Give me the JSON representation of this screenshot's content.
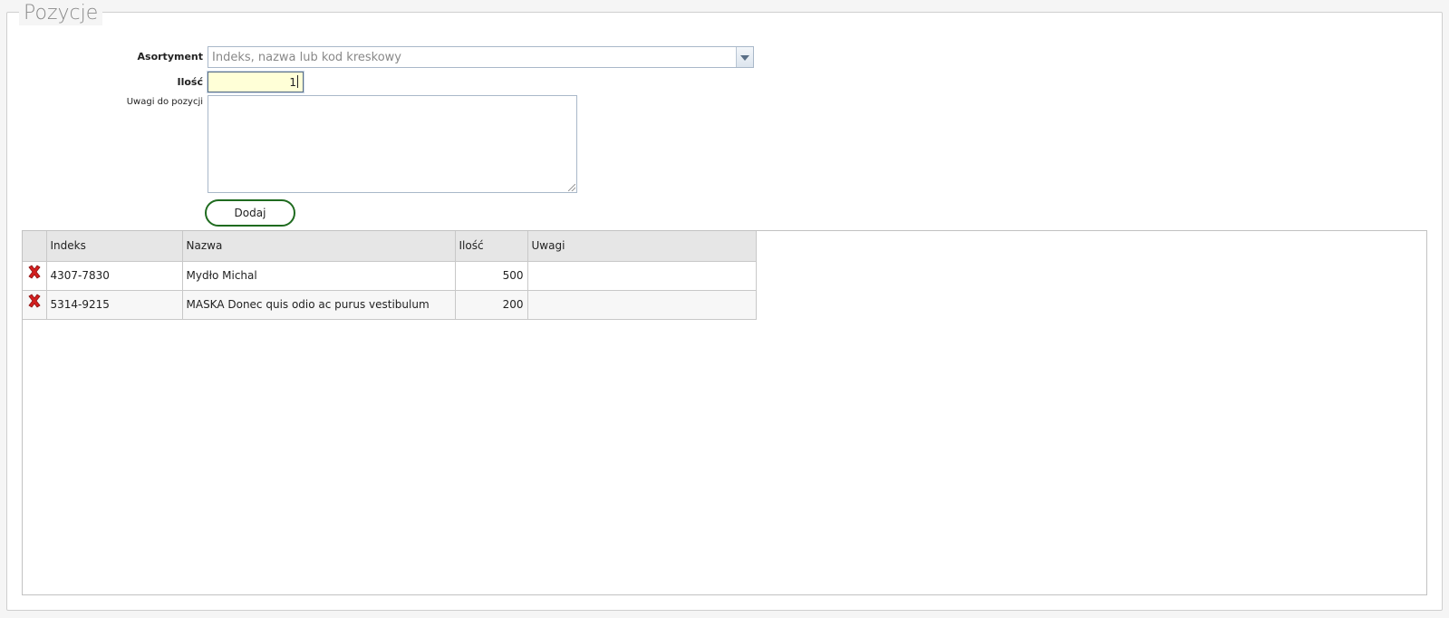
{
  "section": {
    "title": "Pozycje"
  },
  "form": {
    "product_label": "Asortyment",
    "product_placeholder": "Indeks, nazwa lub kod kreskowy",
    "quantity_label": "Ilość",
    "quantity_value": "1",
    "notes_label": "Uwagi do pozycji",
    "notes_value": "",
    "add_button": "Dodaj"
  },
  "table": {
    "headers": {
      "index": "Indeks",
      "name": "Nazwa",
      "qty": "Ilość",
      "notes": "Uwagi"
    },
    "rows": [
      {
        "index": "4307-7830",
        "name": "Mydło Michal",
        "qty": "500",
        "notes": ""
      },
      {
        "index": "5314-9215",
        "name": "MASKA Donec quis odio ac purus vestibulum",
        "qty": "200",
        "notes": ""
      }
    ]
  },
  "colors": {
    "delete_icon": "#d42020",
    "add_button_border": "#1f6b1f",
    "quantity_bg": "#ffffd7"
  },
  "icons": {
    "delete": "x-delete-icon",
    "dropdown": "chevron-down-icon"
  }
}
